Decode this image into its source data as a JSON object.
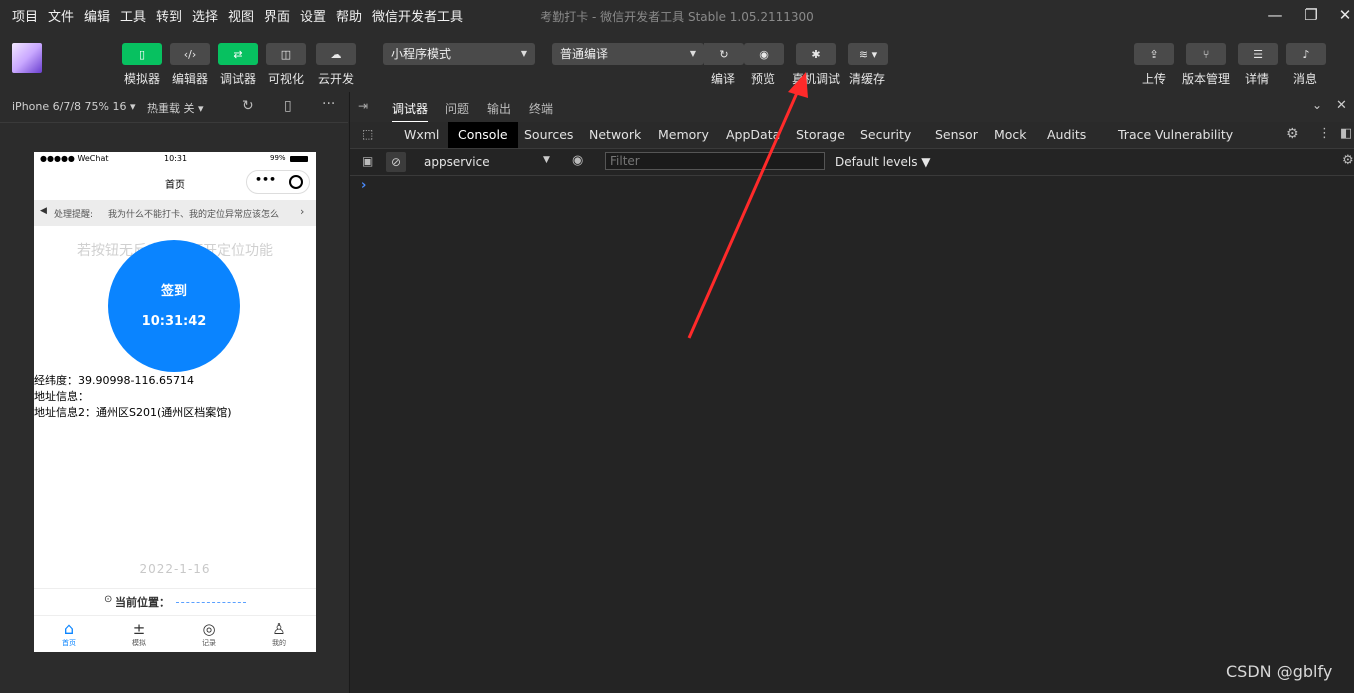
{
  "menubar": {
    "items": [
      "项目",
      "文件",
      "编辑",
      "工具",
      "转到",
      "选择",
      "视图",
      "界面",
      "设置",
      "帮助",
      "微信开发者工具"
    ],
    "window_title": "考勤打卡 - 微信开发者工具 Stable 1.05.2111300"
  },
  "toolbar": {
    "left_buttons": [
      {
        "label": "模拟器",
        "icon": "phone-icon"
      },
      {
        "label": "编辑器",
        "icon": "code-icon"
      },
      {
        "label": "调试器",
        "icon": "debug-toggle-icon"
      },
      {
        "label": "可视化",
        "icon": "layout-icon"
      },
      {
        "label": "云开发",
        "icon": "cloud-icon"
      }
    ],
    "mode_select": "小程序模式",
    "compile_select": "普通编译",
    "actions": [
      {
        "label": "编译",
        "icon": "refresh-icon"
      },
      {
        "label": "预览",
        "icon": "eye-icon"
      },
      {
        "label": "真机调试",
        "icon": "bug-icon"
      },
      {
        "label": "清缓存",
        "icon": "layers-icon"
      }
    ],
    "right_buttons": [
      {
        "label": "上传",
        "icon": "upload-icon"
      },
      {
        "label": "版本管理",
        "icon": "branch-icon"
      },
      {
        "label": "详情",
        "icon": "menu-icon"
      },
      {
        "label": "消息",
        "icon": "bell-icon"
      }
    ]
  },
  "simulator": {
    "device": "iPhone 6/7/8 75% 16 ▾",
    "hot_reload": "热重载 关 ▾",
    "status_bar": {
      "carrier": "●●●●● WeChat",
      "time": "10:31",
      "battery": "99%"
    },
    "nav_title": "首页",
    "notice_label": "处理提醒:",
    "notice_text": "我为什么不能打卡、我的定位异常应该怎么",
    "faded_tip": "若按钮无反应，请打开定位功能",
    "checkin_label": "签到",
    "checkin_time": "10:31:42",
    "info": {
      "coords": "经纬度：39.90998-116.65714",
      "address": "地址信息：",
      "address2": "地址信息2：通州区S201(通州区档案馆)"
    },
    "date": "2022-1-16",
    "location_label": "当前位置：",
    "tabbar": [
      {
        "label": "首页",
        "icon": "home-icon"
      },
      {
        "label": "模拟",
        "icon": "plus-minus-icon"
      },
      {
        "label": "记录",
        "icon": "record-icon"
      },
      {
        "label": "我的",
        "icon": "user-icon"
      }
    ]
  },
  "devtools": {
    "top_tabs": [
      "调试器",
      "问题",
      "输出",
      "终端"
    ],
    "panel_tabs": [
      "Wxml",
      "Console",
      "Sources",
      "Network",
      "Memory",
      "AppData",
      "Storage",
      "Security",
      "Sensor",
      "Mock",
      "Audits",
      "Trace",
      "Vulnerability"
    ],
    "active_panel": "Console",
    "context": "appservice",
    "filter_placeholder": "Filter",
    "levels": "Default levels ▼",
    "prompt": "›"
  },
  "watermark": "CSDN @gblfy",
  "colors": {
    "accent_green": "#07c160",
    "checkin_blue": "#0a84ff",
    "arrow_red": "#ff2a2a"
  }
}
